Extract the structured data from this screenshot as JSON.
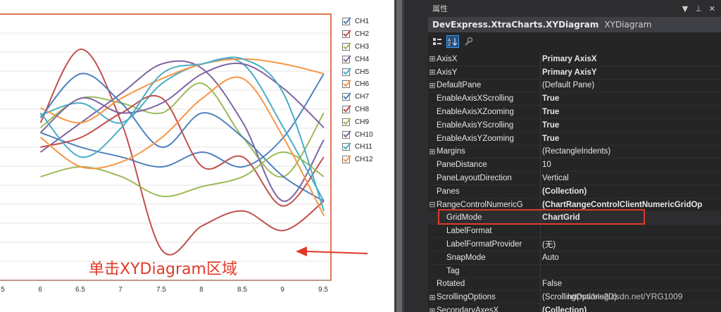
{
  "chart": {
    "legend": [
      "CH1",
      "CH2",
      "CH3",
      "CH4",
      "CH5",
      "CH6",
      "CH7",
      "CH8",
      "CH9",
      "CH10",
      "CH11",
      "CH12"
    ],
    "colors": [
      "#4f81bd",
      "#c0504d",
      "#9bbb59",
      "#8064a2",
      "#4bacc6",
      "#f79646",
      "#4f81bd",
      "#c0504d",
      "#9bbb59",
      "#8064a2",
      "#4bacc6",
      "#f79646"
    ],
    "x_ticks": [
      "5",
      "6",
      "6.5",
      "7",
      "7.5",
      "8",
      "8.5",
      "9",
      "9.5"
    ],
    "annotation": "单击XYDiagram区域",
    "highlight_color": "#e03a2a"
  },
  "chart_data": {
    "type": "line",
    "x": [
      5.5,
      6,
      6.5,
      7,
      7.5,
      8,
      8.5,
      9
    ],
    "ylim": [
      0,
      100
    ],
    "series": [
      {
        "name": "CH1",
        "values": [
          58,
          52,
          48,
          44,
          50,
          44,
          56,
          82
        ]
      },
      {
        "name": "CH2",
        "values": [
          62,
          92,
          62,
          10,
          20,
          26,
          18,
          30
        ]
      },
      {
        "name": "CH3",
        "values": [
          60,
          72,
          70,
          66,
          78,
          56,
          40,
          66
        ]
      },
      {
        "name": "CH4",
        "values": [
          50,
          62,
          74,
          86,
          84,
          62,
          30,
          55
        ]
      },
      {
        "name": "CH5",
        "values": [
          65,
          70,
          62,
          78,
          86,
          86,
          60,
          30
        ]
      },
      {
        "name": "CH6",
        "values": [
          68,
          62,
          72,
          80,
          86,
          88,
          86,
          82
        ]
      },
      {
        "name": "CH7",
        "values": [
          64,
          82,
          70,
          52,
          66,
          56,
          40,
          30
        ]
      },
      {
        "name": "CH8",
        "values": [
          52,
          56,
          66,
          72,
          44,
          48,
          28,
          48
        ]
      },
      {
        "name": "CH9",
        "values": [
          40,
          44,
          40,
          32,
          36,
          40,
          50,
          40
        ]
      },
      {
        "name": "CH10",
        "values": [
          58,
          72,
          66,
          70,
          82,
          86,
          76,
          60
        ]
      },
      {
        "name": "CH11",
        "values": [
          66,
          48,
          60,
          82,
          86,
          88,
          74,
          26
        ]
      },
      {
        "name": "CH12",
        "values": [
          56,
          44,
          46,
          56,
          72,
          80,
          56,
          24
        ]
      }
    ]
  },
  "props": {
    "title": "属性",
    "title_buttons": [
      "▼",
      "⊥",
      "✕"
    ],
    "object_name": "DevExpress.XtraCharts.XYDiagram",
    "object_type": "XYDiagram",
    "toolbar": {
      "categorized": "categorized-icon",
      "alphabetical": "alphabetical-icon",
      "property_pages": "wrench-icon"
    },
    "rows": [
      {
        "exp": "⊞",
        "name": "AxisX",
        "value": "Primary AxisX",
        "bold": true
      },
      {
        "exp": "⊞",
        "name": "AxisY",
        "value": "Primary AxisY",
        "bold": true
      },
      {
        "exp": "⊞",
        "name": "DefaultPane",
        "value": "(Default Pane)",
        "bold": false
      },
      {
        "exp": "",
        "name": "EnableAxisXScrolling",
        "value": "True",
        "bold": true
      },
      {
        "exp": "",
        "name": "EnableAxisXZooming",
        "value": "True",
        "bold": true
      },
      {
        "exp": "",
        "name": "EnableAxisYScrolling",
        "value": "True",
        "bold": true
      },
      {
        "exp": "",
        "name": "EnableAxisYZooming",
        "value": "True",
        "bold": true
      },
      {
        "exp": "⊞",
        "name": "Margins",
        "value": "(RectangleIndents)",
        "bold": false
      },
      {
        "exp": "",
        "name": "PaneDistance",
        "value": "10",
        "bold": false
      },
      {
        "exp": "",
        "name": "PaneLayoutDirection",
        "value": "Vertical",
        "bold": false
      },
      {
        "exp": "",
        "name": "Panes",
        "value": "(Collection)",
        "bold": true
      },
      {
        "exp": "⊟",
        "name": "RangeControlNumericG",
        "value": "(ChartRangeControlClientNumericGridOp",
        "bold": true
      },
      {
        "exp": "",
        "name": "GridMode",
        "value": "ChartGrid",
        "bold": true,
        "child": true,
        "selected": true
      },
      {
        "exp": "",
        "name": "LabelFormat",
        "value": "",
        "bold": false,
        "child": true
      },
      {
        "exp": "",
        "name": "LabelFormatProvider",
        "value": "(无)",
        "bold": false,
        "child": true
      },
      {
        "exp": "",
        "name": "SnapMode",
        "value": "Auto",
        "bold": false,
        "child": true
      },
      {
        "exp": "",
        "name": "Tag",
        "value": "",
        "bold": false,
        "child": true
      },
      {
        "exp": "",
        "name": "Rotated",
        "value": "False",
        "bold": false
      },
      {
        "exp": "⊞",
        "name": "ScrollingOptions",
        "value": "(ScrollingOptions2D)",
        "bold": false
      },
      {
        "exp": "⊞",
        "name": "SecondaryAxesX",
        "value": "(Collection)",
        "bold": true
      }
    ]
  },
  "watermark": "https://blog.csdn.net/YRG1009"
}
